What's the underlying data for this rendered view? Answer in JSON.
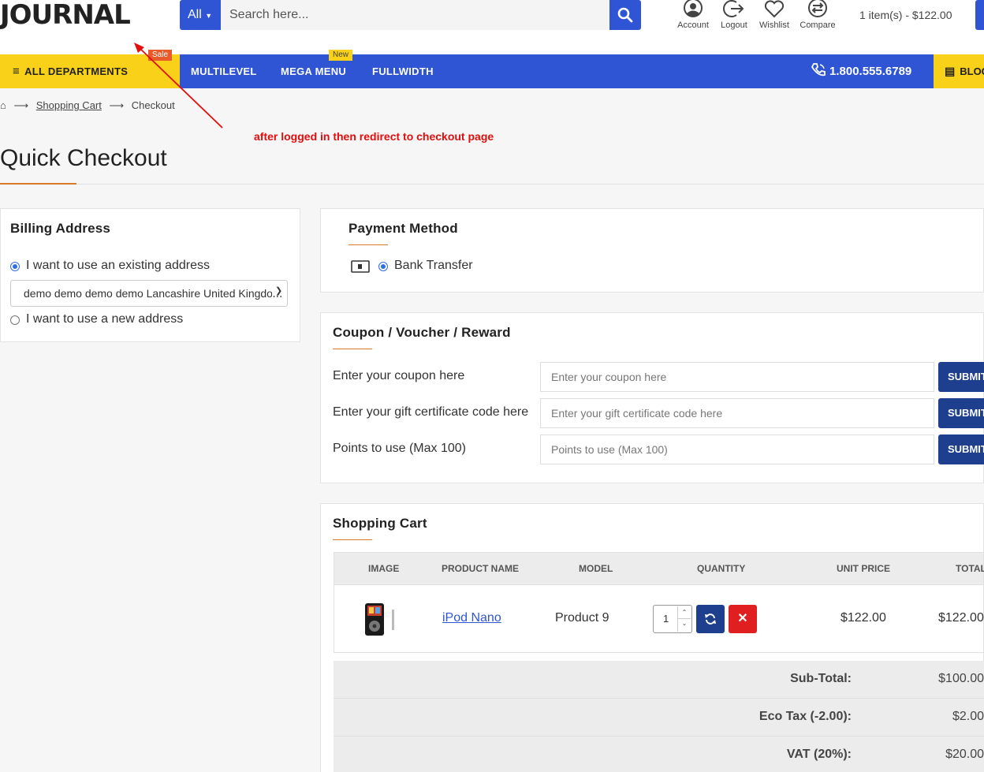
{
  "header": {
    "logo": "JOURNAL",
    "search_category": "All",
    "search_placeholder": "Search here...",
    "icons": [
      {
        "name": "account-icon",
        "label": "Account"
      },
      {
        "name": "logout-icon",
        "label": "Logout"
      },
      {
        "name": "wishlist-icon",
        "label": "Wishlist"
      },
      {
        "name": "compare-icon",
        "label": "Compare"
      }
    ],
    "cart_summary": "1 item(s) - $122.00"
  },
  "nav": {
    "departments": "ALL DEPARTMENTS",
    "items": [
      "MULTILEVEL",
      "MEGA MENU",
      "FULLWIDTH"
    ],
    "badges": {
      "sale": "Sale",
      "new": "New"
    },
    "phone": "1.800.555.6789",
    "blog": "BLOG"
  },
  "breadcrumb": {
    "cart": "Shopping Cart",
    "current": "Checkout"
  },
  "annotation": "after logged in then redirect to checkout page",
  "page_title": "Quick Checkout",
  "billing": {
    "title": "Billing Address",
    "existing_label": "I want to use an existing address",
    "address_value": "demo demo demo demo Lancashire United Kingdom",
    "new_label": "I want to use a new address"
  },
  "payment": {
    "title": "Payment Method",
    "option": "Bank Transfer"
  },
  "coupon": {
    "title": "Coupon / Voucher / Reward",
    "rows": [
      {
        "label": "Enter your coupon here",
        "placeholder": "Enter your coupon here",
        "button": "SUBMIT"
      },
      {
        "label": "Enter your gift certificate code here",
        "placeholder": "Enter your gift certificate code here",
        "button": "SUBMIT"
      },
      {
        "label": "Points to use (Max 100)",
        "placeholder": "Points to use (Max 100)",
        "button": "SUBMIT"
      }
    ]
  },
  "cart": {
    "title": "Shopping Cart",
    "columns": [
      "IMAGE",
      "PRODUCT NAME",
      "MODEL",
      "QUANTITY",
      "UNIT PRICE",
      "TOTAL"
    ],
    "item": {
      "name": "iPod Nano",
      "model": "Product 9",
      "quantity": "1",
      "unit_price": "$122.00",
      "total": "$122.00"
    },
    "totals": [
      {
        "label": "Sub-Total:",
        "value": "$100.00"
      },
      {
        "label": "Eco Tax (-2.00):",
        "value": "$2.00"
      },
      {
        "label": "VAT (20%):",
        "value": "$20.00"
      }
    ]
  },
  "colors": {
    "primary": "#2f55d4",
    "accent_yellow": "#f8d118",
    "button_dark": "#1d3f8e",
    "danger": "#e02020",
    "annotation_red": "#e20d0d"
  }
}
